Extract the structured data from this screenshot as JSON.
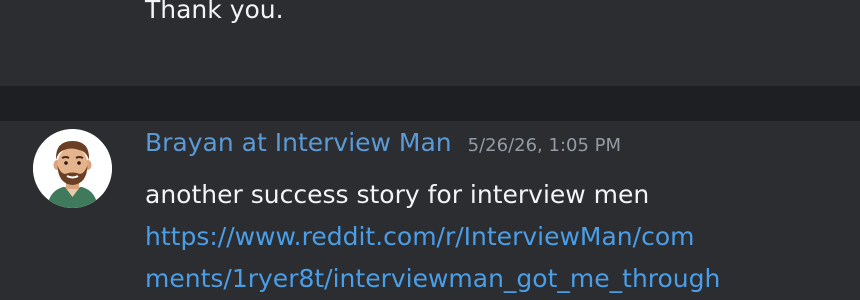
{
  "previous_message": {
    "text": "Thank you."
  },
  "message": {
    "author": "Brayan at Interview Man",
    "timestamp": "5/26/26, 1:05 PM",
    "text": "another success story for interview men",
    "link_line1": "https://www.reddit.com/r/InterviewMan/com",
    "link_line2": "ments/1ryer8t/interviewman_got_me_through",
    "avatar_icon": "bearded-man-avatar-icon"
  },
  "colors": {
    "background": "#2b2d31",
    "separator": "#1e1f22",
    "author": "#5b9ad6",
    "link": "#4a9ee8",
    "timestamp": "#949ba4",
    "text": "#f2f3f5"
  }
}
